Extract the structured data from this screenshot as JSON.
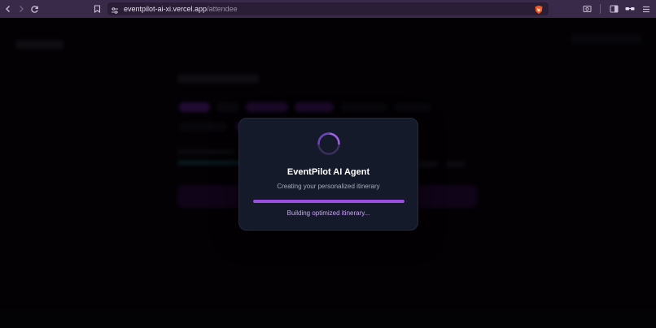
{
  "browser": {
    "url_host": "eventpilot-ai-xi.vercel.app",
    "url_path": "/attendee",
    "icons": [
      "back-icon",
      "forward-icon",
      "reload-icon",
      "bookmark-icon",
      "site-settings-icon",
      "brave-shield-icon",
      "screenshot-icon",
      "sidebar-icon",
      "extensions-icon",
      "menu-icon"
    ]
  },
  "modal": {
    "title": "EventPilot AI Agent",
    "subtitle": "Creating your personalized itinerary",
    "status": "Building optimized itinerary...",
    "progress": 1.0
  },
  "colors": {
    "accent": "#9b4fe0",
    "modal_bg": "#151a2a",
    "chrome_bg": "#3a2a4a"
  }
}
